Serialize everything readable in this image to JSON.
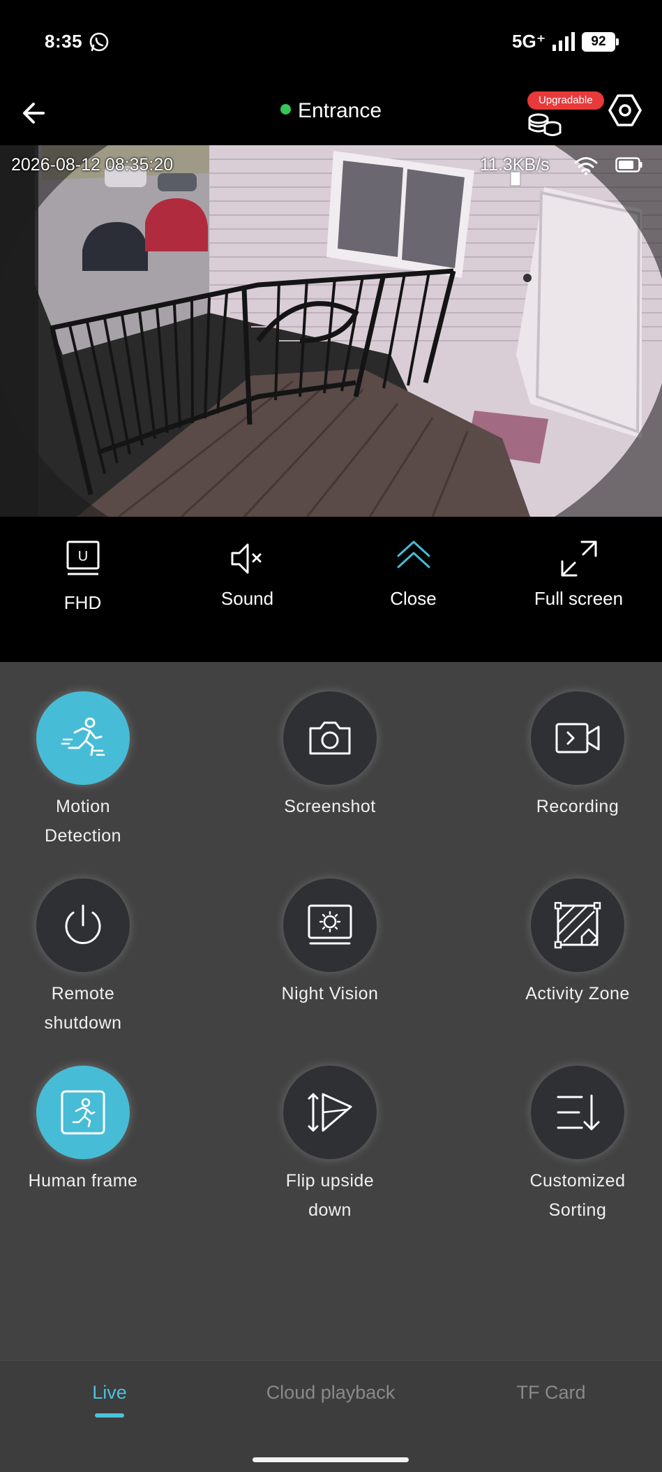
{
  "status_bar": {
    "time": "8:35",
    "network": "5G⁺",
    "battery": "92",
    "icons": [
      "whatsapp-icon",
      "signal-icon",
      "battery-icon"
    ]
  },
  "header": {
    "title": "Entrance",
    "online_color": "#34c759",
    "upgrade_badge": "Upgradable",
    "icons": [
      "back-arrow-icon",
      "cloud-storage-icon",
      "settings-hexagon-icon"
    ]
  },
  "video": {
    "timestamp": "2026-08-12 08:35:20",
    "bitrate": "11.3KB/s",
    "icons": [
      "wifi-icon",
      "camera-battery-icon"
    ]
  },
  "controls": [
    {
      "id": "fhd",
      "label": "FHD",
      "icon": "quality-u-icon"
    },
    {
      "id": "sound",
      "label": "Sound",
      "icon": "speaker-muted-icon"
    },
    {
      "id": "close",
      "label": "Close",
      "icon": "chevron-up-double-icon"
    },
    {
      "id": "full",
      "label": "Full screen",
      "icon": "expand-icon"
    }
  ],
  "functions": {
    "motion": {
      "label_1": "Motion",
      "label_2": "Detection",
      "active": true
    },
    "screenshot": {
      "label_1": "Screenshot",
      "active": false
    },
    "recording": {
      "label_1": "Recording",
      "active": false
    },
    "shutdown": {
      "label_1": "Remote",
      "label_2": "shutdown",
      "active": false
    },
    "night": {
      "label_1": "Night Vision",
      "active": false
    },
    "zone": {
      "label_1": "Activity Zone",
      "active": false
    },
    "human": {
      "label_1": "Human frame",
      "active": true
    },
    "flip": {
      "label_1": "Flip upside",
      "label_2": "down",
      "active": false
    },
    "sorting": {
      "label_1": "Customized",
      "label_2": "Sorting",
      "active": false
    }
  },
  "tabs": {
    "live": "Live",
    "cloud": "Cloud playback",
    "tf": "TF Card",
    "active": "Live"
  },
  "colors": {
    "accent": "#47bcd6",
    "panel": "#424242",
    "circle": "#2f3034",
    "badge": "#e83a3a"
  }
}
